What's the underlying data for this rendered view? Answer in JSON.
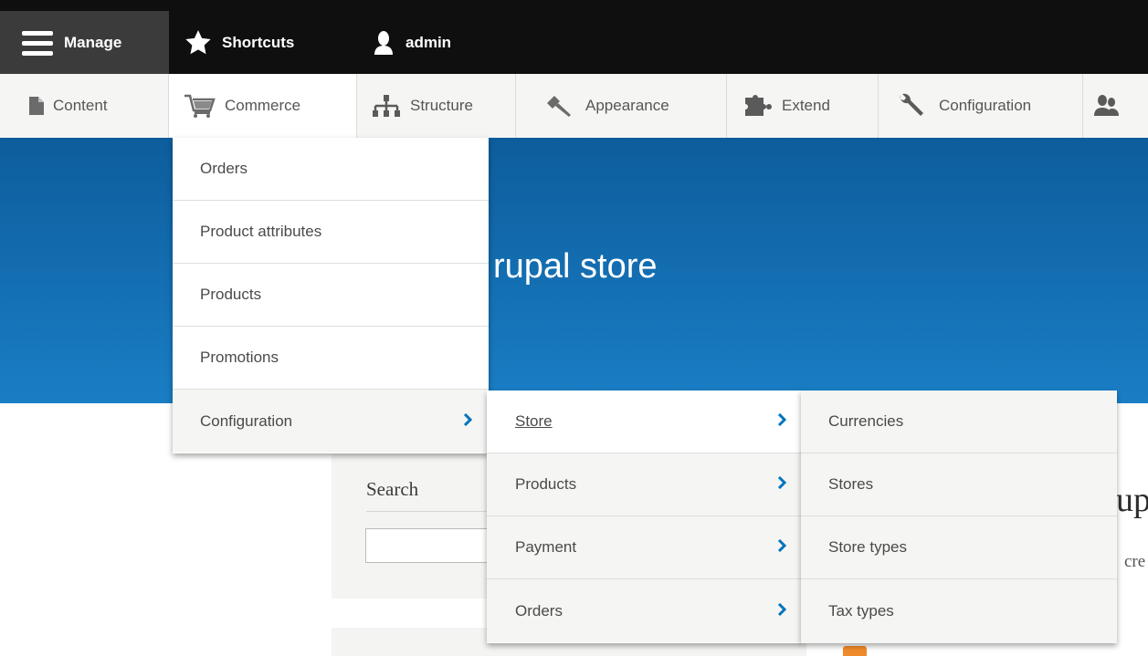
{
  "toolbar": {
    "manage": "Manage",
    "shortcuts": "Shortcuts",
    "user": "admin"
  },
  "tray": {
    "items": [
      {
        "label": "Content",
        "icon": "file-icon"
      },
      {
        "label": "Commerce",
        "icon": "cart-icon"
      },
      {
        "label": "Structure",
        "icon": "sitemap-icon"
      },
      {
        "label": "Appearance",
        "icon": "paintbrush-icon"
      },
      {
        "label": "Extend",
        "icon": "puzzle-icon"
      },
      {
        "label": "Configuration",
        "icon": "wrench-icon"
      },
      {
        "label": "",
        "icon": "people-icon"
      }
    ]
  },
  "hero": {
    "title_visible": "rupal store"
  },
  "sidebar": {
    "search_label": "Search"
  },
  "page_edge": {
    "text1": "up",
    "text2": "cre"
  },
  "commerce_menu": {
    "items": [
      "Orders",
      "Product attributes",
      "Products",
      "Promotions",
      "Configuration"
    ]
  },
  "configuration_menu": {
    "items": [
      "Store",
      "Products",
      "Payment",
      "Orders"
    ]
  },
  "store_menu": {
    "items": [
      "Currencies",
      "Stores",
      "Store types",
      "Tax types"
    ]
  },
  "colors": {
    "toolbar_bg": "#0f0f0f",
    "manage_bg": "#3b3b3b",
    "hero_top": "#0d5d9c",
    "hero_bottom": "#1a7ec5",
    "chevron": "#0074bd"
  }
}
